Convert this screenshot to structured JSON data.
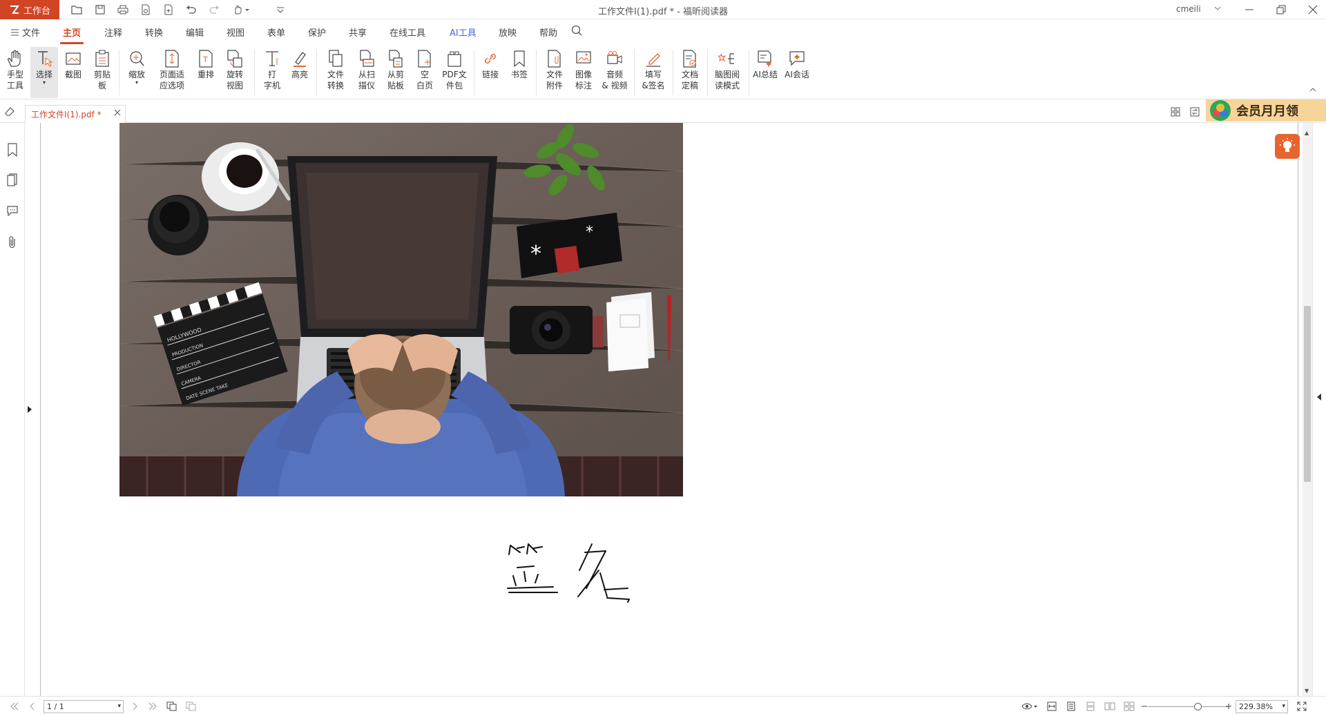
{
  "titlebar": {
    "workbench_label": "工作台",
    "window_title": "工作文件I(1).pdf * - 福昕阅读器",
    "user_name": "cmeili"
  },
  "menu": {
    "file": "文件",
    "tabs": [
      "主页",
      "注释",
      "转换",
      "编辑",
      "视图",
      "表单",
      "保护",
      "共享",
      "在线工具",
      "AI工具",
      "放映",
      "帮助"
    ],
    "active_tab": "主页"
  },
  "ribbon": {
    "hand_tool": "手型\n工具",
    "select": "选择",
    "screenshot": "截图",
    "clipboard": "剪贴\n板",
    "zoom": "缩放",
    "fit_page": "页面适\n应选项",
    "reflow": "重排",
    "rotate_view": "旋转\n视图",
    "typewriter": "打\n字机",
    "highlight": "高亮",
    "file_convert": "文件\n转换",
    "from_scanner": "从扫\n描仪",
    "from_clipboard": "从剪\n贴板",
    "blank_page": "空\n白页",
    "pdf_portfolio": "PDF文\n件包",
    "link": "链接",
    "bookmark": "书签",
    "file_attachment": "文件\n附件",
    "image_annotation": "图像\n标注",
    "audio_video": "音频\n& 视频",
    "fill_sign": "填写\n&签名",
    "doc_finalize": "文档\n定稿",
    "mindmap_mode": "脑图阅\n读模式",
    "ai_summary": "AI总结",
    "ai_chat": "AI会话"
  },
  "tabbar": {
    "doc_tab": "工作文件I(1).pdf *",
    "vip_banner": "会员月月领"
  },
  "document": {
    "signature_text": "签 名"
  },
  "status": {
    "page_value": "1 / 1",
    "zoom_value": "229.38%"
  },
  "colors": {
    "brand": "#d14524",
    "ai_accent": "#4a64e8",
    "vip_bg": "#f7d59a"
  }
}
